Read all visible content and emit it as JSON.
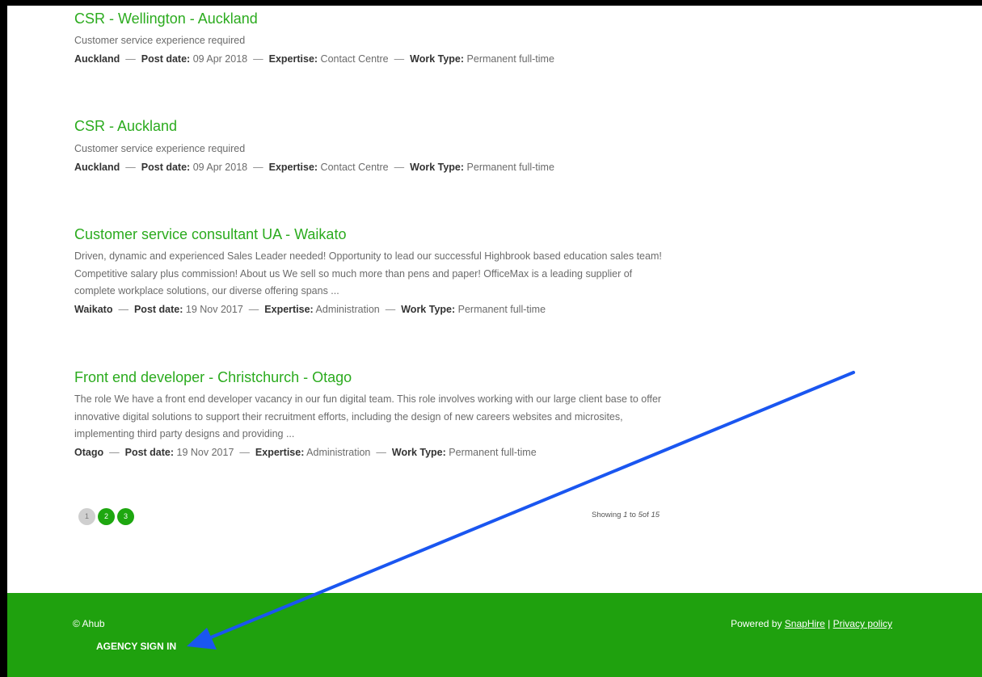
{
  "jobs": [
    {
      "title": "CSR - Wellington - Auckland",
      "description": "Customer service experience required",
      "location": "Auckland",
      "post_date_label": "Post date:",
      "post_date": "09 Apr 2018",
      "expertise_label": "Expertise:",
      "expertise": "Contact Centre",
      "work_type_label": "Work Type:",
      "work_type": "Permanent full-time"
    },
    {
      "title": "CSR - Auckland",
      "description": "Customer service experience required",
      "location": "Auckland",
      "post_date_label": "Post date:",
      "post_date": "09 Apr 2018",
      "expertise_label": "Expertise:",
      "expertise": "Contact Centre",
      "work_type_label": "Work Type:",
      "work_type": "Permanent full-time"
    },
    {
      "title": "Customer service consultant UA - Waikato",
      "description": "Driven, dynamic and experienced Sales Leader needed! Opportunity to lead our successful Highbrook based education sales team! Competitive salary plus commission! About us We sell so much more than pens and paper! OfficeMax is a leading supplier of complete workplace solutions, our diverse offering spans ...",
      "location": "Waikato",
      "post_date_label": "Post date:",
      "post_date": "19 Nov 2017",
      "expertise_label": "Expertise:",
      "expertise": "Administration",
      "work_type_label": "Work Type:",
      "work_type": "Permanent full-time"
    },
    {
      "title": "Front end developer - Christchurch - Otago",
      "description": "The role We have a front end developer vacancy in our fun digital team. This role involves working with our large client base to offer innovative digital solutions to support their recruitment efforts, including the design of new careers websites and microsites, implementing third party designs and providing ...",
      "location": "Otago",
      "post_date_label": "Post date:",
      "post_date": "19 Nov 2017",
      "expertise_label": "Expertise:",
      "expertise": "Administration",
      "work_type_label": "Work Type:",
      "work_type": "Permanent full-time"
    }
  ],
  "pagination": {
    "pages": [
      "1",
      "2",
      "3"
    ],
    "current": "1",
    "showing_prefix": "Showing",
    "showing_from": "1",
    "showing_to_label": "to",
    "showing_to": "5",
    "showing_of_label": "of",
    "showing_total": "15"
  },
  "footer": {
    "copyright": "© Ahub",
    "agency_sign_in": "AGENCY SIGN IN",
    "powered_by": "Powered by",
    "snaphire": "SnapHire",
    "separator": "|",
    "privacy": "Privacy policy"
  },
  "colors": {
    "accent": "#2bab1e",
    "footer_bg": "#1fa10e",
    "annotation_arrow": "#1a56f0"
  }
}
